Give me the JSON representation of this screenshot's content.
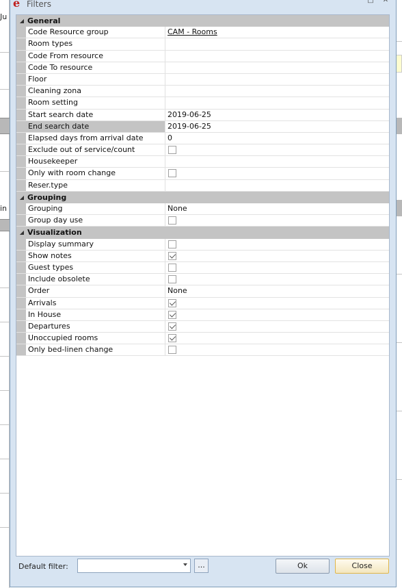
{
  "window": {
    "title": "Filters",
    "app_icon": "e"
  },
  "background": {
    "left_texts": [
      "Ju",
      "in"
    ]
  },
  "sections": [
    {
      "name": "General",
      "rows": [
        {
          "label": "Code Resource group",
          "value": "CAM - Rooms",
          "kind": "link"
        },
        {
          "label": "Room types",
          "value": "",
          "kind": "text"
        },
        {
          "label": "Code From resource",
          "value": "",
          "kind": "text"
        },
        {
          "label": "Code To resource",
          "value": "",
          "kind": "text"
        },
        {
          "label": "Floor",
          "value": "",
          "kind": "text"
        },
        {
          "label": "Cleaning zona",
          "value": "",
          "kind": "text"
        },
        {
          "label": "Room setting",
          "value": "",
          "kind": "text"
        },
        {
          "label": "Start search date",
          "value": "2019-06-25",
          "kind": "text"
        },
        {
          "label": "End search date",
          "value": "2019-06-25",
          "kind": "text",
          "selected": true
        },
        {
          "label": "Elapsed days from arrival date",
          "value": "0",
          "kind": "text"
        },
        {
          "label": "Exclude out of service/count",
          "checked": false,
          "kind": "check"
        },
        {
          "label": "Housekeeper",
          "value": "",
          "kind": "text"
        },
        {
          "label": "Only with room change",
          "checked": false,
          "kind": "check"
        },
        {
          "label": "Reser.type",
          "value": "",
          "kind": "text"
        }
      ]
    },
    {
      "name": "Grouping",
      "rows": [
        {
          "label": "Grouping",
          "value": "None",
          "kind": "text"
        },
        {
          "label": "Group day use",
          "checked": false,
          "kind": "check"
        }
      ]
    },
    {
      "name": "Visualization",
      "rows": [
        {
          "label": "Display summary",
          "checked": false,
          "kind": "check"
        },
        {
          "label": "Show notes",
          "checked": true,
          "kind": "check"
        },
        {
          "label": "Guest types",
          "checked": false,
          "kind": "check"
        },
        {
          "label": "Include obsolete",
          "checked": false,
          "kind": "check"
        },
        {
          "label": "Order",
          "value": "None",
          "kind": "text"
        },
        {
          "label": "Arrivals",
          "checked": true,
          "kind": "check"
        },
        {
          "label": "In House",
          "checked": true,
          "kind": "check"
        },
        {
          "label": "Departures",
          "checked": true,
          "kind": "check"
        },
        {
          "label": "Unoccupied rooms",
          "checked": true,
          "kind": "check"
        },
        {
          "label": "Only bed-linen change",
          "checked": false,
          "kind": "check"
        }
      ]
    }
  ],
  "footer": {
    "default_filter_label": "Default filter:",
    "default_filter_value": "",
    "more_label": "...",
    "ok_label": "Ok",
    "close_label": "Close"
  },
  "colors": {
    "window_bg": "#d7e4f2",
    "category_bg": "#c4c4c4",
    "close_button_border": "#e0b64a",
    "app_icon_color": "#c0201f"
  }
}
